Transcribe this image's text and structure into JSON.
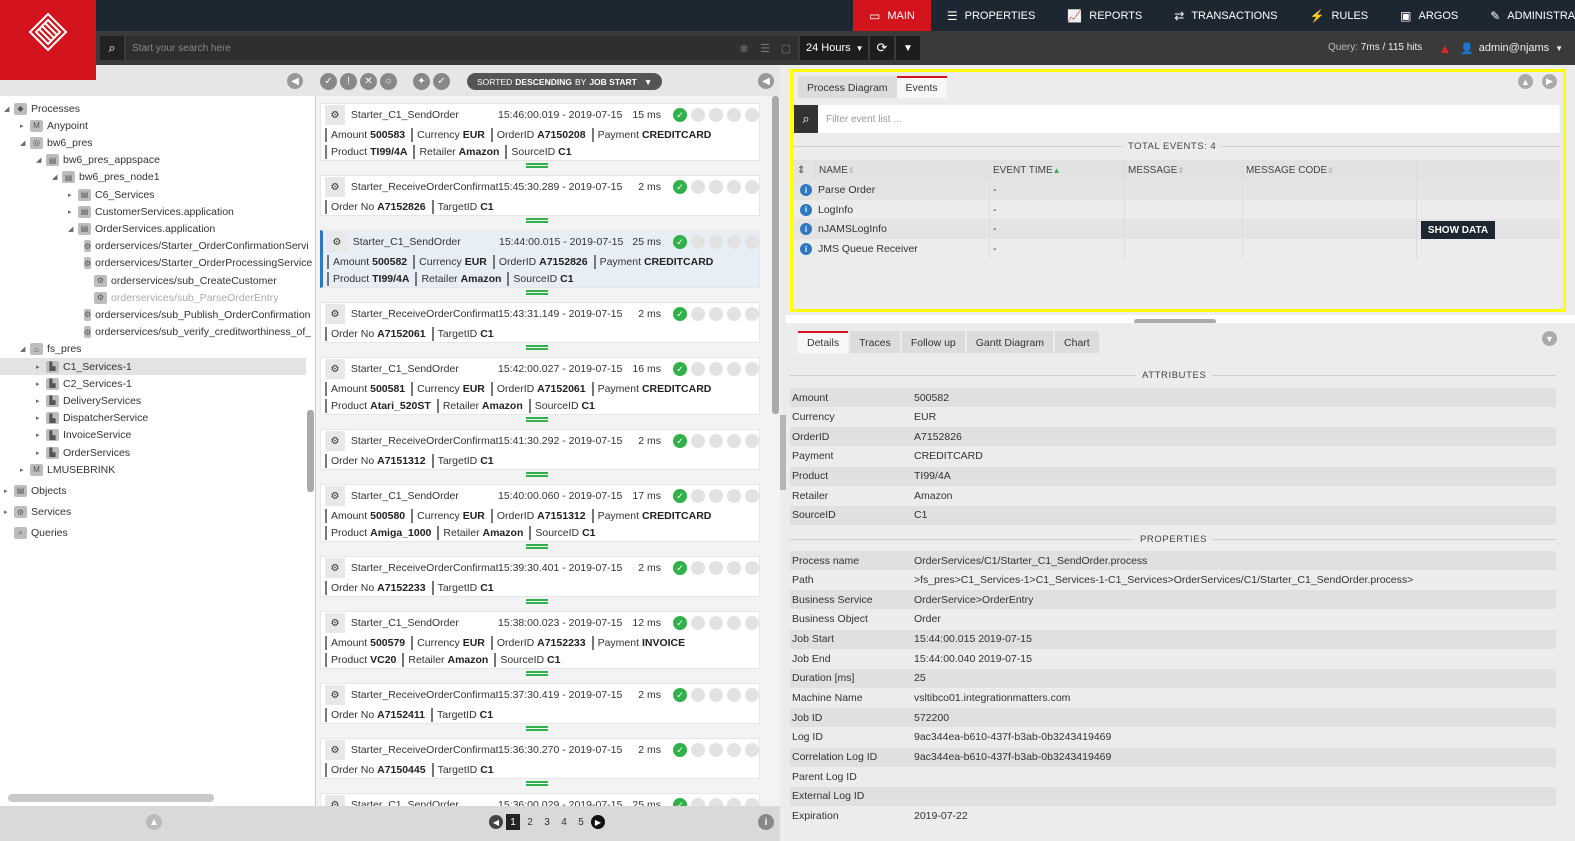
{
  "nav": {
    "items": [
      {
        "label": "MAIN",
        "icon": "monitor-icon",
        "glyph": "▭",
        "active": true
      },
      {
        "label": "PROPERTIES",
        "icon": "list-icon",
        "glyph": "☰",
        "active": false
      },
      {
        "label": "REPORTS",
        "icon": "chart-icon",
        "glyph": "📈",
        "active": false
      },
      {
        "label": "TRANSACTIONS",
        "icon": "exchange-icon",
        "glyph": "⇄",
        "active": false
      },
      {
        "label": "RULES",
        "icon": "bolt-icon",
        "glyph": "⚡",
        "active": false
      },
      {
        "label": "ARGOS",
        "icon": "window-icon",
        "glyph": "▣",
        "active": false
      },
      {
        "label": "ADMINISTRATION",
        "icon": "wrench-icon",
        "glyph": "✎",
        "active": false
      }
    ]
  },
  "search": {
    "placeholder": "Start your search here",
    "timerange": "24 Hours"
  },
  "query": {
    "label": "Query:",
    "value": "7ms / 115 hits"
  },
  "user": {
    "name": "admin@njams"
  },
  "tree": [
    {
      "label": "Processes",
      "indent": 0,
      "tw": "◢",
      "icon": "◆"
    },
    {
      "label": "Anypoint",
      "indent": 1,
      "tw": "▸",
      "icon": "M"
    },
    {
      "label": "bw6_pres",
      "indent": 1,
      "tw": "◢",
      "icon": "◎"
    },
    {
      "label": "bw6_pres_appspace",
      "indent": 2,
      "tw": "◢",
      "icon": "▤"
    },
    {
      "label": "bw6_pres_node1",
      "indent": 3,
      "tw": "◢",
      "icon": "▤"
    },
    {
      "label": "C6_Services",
      "indent": 4,
      "tw": "▸",
      "icon": "▤"
    },
    {
      "label": "CustomerServices.application",
      "indent": 4,
      "tw": "▸",
      "icon": "▤"
    },
    {
      "label": "OrderServices.application",
      "indent": 4,
      "tw": "◢",
      "icon": "▤"
    },
    {
      "label": "orderservices/Starter_OrderConfirmationServi",
      "indent": 5,
      "tw": "",
      "icon": "⚙"
    },
    {
      "label": "orderservices/Starter_OrderProcessingService",
      "indent": 5,
      "tw": "",
      "icon": "⚙"
    },
    {
      "label": "orderservices/sub_CreateCustomer",
      "indent": 5,
      "tw": "",
      "icon": "⚙"
    },
    {
      "label": "orderservices/sub_ParseOrderEntry",
      "indent": 5,
      "tw": "",
      "icon": "⚙",
      "dim": true
    },
    {
      "label": "orderservices/sub_Publish_OrderConfirmation",
      "indent": 5,
      "tw": "",
      "icon": "⚙"
    },
    {
      "label": "orderservices/sub_verify_creditworthiness_of_",
      "indent": 5,
      "tw": "",
      "icon": "⚙"
    },
    {
      "label": "fs_pres",
      "indent": 1,
      "tw": "◢",
      "icon": "⌂"
    },
    {
      "label": "C1_Services-1",
      "indent": 2,
      "tw": "▸",
      "icon": "▙",
      "sel": true
    },
    {
      "label": "C2_Services-1",
      "indent": 2,
      "tw": "▸",
      "icon": "▙"
    },
    {
      "label": "DeliveryServices",
      "indent": 2,
      "tw": "▸",
      "icon": "▙"
    },
    {
      "label": "DispatcherService",
      "indent": 2,
      "tw": "▸",
      "icon": "▙"
    },
    {
      "label": "InvoiceService",
      "indent": 2,
      "tw": "▸",
      "icon": "▙"
    },
    {
      "label": "OrderServices",
      "indent": 2,
      "tw": "▸",
      "icon": "▙"
    },
    {
      "label": "LMUSEBRINK",
      "indent": 1,
      "tw": "▸",
      "icon": "M"
    },
    {
      "label": "Objects",
      "indent": 0,
      "tw": "▸",
      "icon": "▤"
    },
    {
      "label": "Services",
      "indent": 0,
      "tw": "▸",
      "icon": "⚙"
    },
    {
      "label": "Queries",
      "indent": 0,
      "tw": "",
      "icon": "⌕"
    }
  ],
  "sorted": {
    "prefix": "SORTED",
    "strong": "DESCENDING",
    "by": "BY",
    "field": "JOB START"
  },
  "jobs": [
    {
      "name": "Starter_C1_SendOrder",
      "time": "15:46:00.019 - 2019-07-15",
      "dur": "15 ms",
      "attrs": [
        [
          "Amount",
          "500583"
        ],
        [
          "Currency",
          "EUR"
        ],
        [
          "OrderID",
          "A7150208"
        ],
        [
          "Payment",
          "CREDITCARD"
        ],
        [
          "Product",
          "TI99/4A"
        ],
        [
          "Retailer",
          "Amazon"
        ],
        [
          "SourceID",
          "C1"
        ]
      ]
    },
    {
      "name": "Starter_ReceiveOrderConfirmat",
      "time": "15:45:30.289 - 2019-07-15",
      "dur": "2 ms",
      "attrs": [
        [
          "Order No",
          "A7152826"
        ],
        [
          "TargetID",
          "C1"
        ]
      ]
    },
    {
      "name": "Starter_C1_SendOrder",
      "time": "15:44:00.015 - 2019-07-15",
      "dur": "25 ms",
      "sel": true,
      "attrs": [
        [
          "Amount",
          "500582"
        ],
        [
          "Currency",
          "EUR"
        ],
        [
          "OrderID",
          "A7152826"
        ],
        [
          "Payment",
          "CREDITCARD"
        ],
        [
          "Product",
          "TI99/4A"
        ],
        [
          "Retailer",
          "Amazon"
        ],
        [
          "SourceID",
          "C1"
        ]
      ]
    },
    {
      "name": "Starter_ReceiveOrderConfirmat",
      "time": "15:43:31.149 - 2019-07-15",
      "dur": "2 ms",
      "attrs": [
        [
          "Order No",
          "A7152061"
        ],
        [
          "TargetID",
          "C1"
        ]
      ]
    },
    {
      "name": "Starter_C1_SendOrder",
      "time": "15:42:00.027 - 2019-07-15",
      "dur": "16 ms",
      "attrs": [
        [
          "Amount",
          "500581"
        ],
        [
          "Currency",
          "EUR"
        ],
        [
          "OrderID",
          "A7152061"
        ],
        [
          "Payment",
          "CREDITCARD"
        ],
        [
          "Product",
          "Atari_520ST"
        ],
        [
          "Retailer",
          "Amazon"
        ],
        [
          "SourceID",
          "C1"
        ]
      ]
    },
    {
      "name": "Starter_ReceiveOrderConfirmat",
      "time": "15:41:30.292 - 2019-07-15",
      "dur": "2 ms",
      "attrs": [
        [
          "Order No",
          "A7151312"
        ],
        [
          "TargetID",
          "C1"
        ]
      ]
    },
    {
      "name": "Starter_C1_SendOrder",
      "time": "15:40:00.060 - 2019-07-15",
      "dur": "17 ms",
      "attrs": [
        [
          "Amount",
          "500580"
        ],
        [
          "Currency",
          "EUR"
        ],
        [
          "OrderID",
          "A7151312"
        ],
        [
          "Payment",
          "CREDITCARD"
        ],
        [
          "Product",
          "Amiga_1000"
        ],
        [
          "Retailer",
          "Amazon"
        ],
        [
          "SourceID",
          "C1"
        ]
      ]
    },
    {
      "name": "Starter_ReceiveOrderConfirmat",
      "time": "15:39:30.401 - 2019-07-15",
      "dur": "2 ms",
      "attrs": [
        [
          "Order No",
          "A7152233"
        ],
        [
          "TargetID",
          "C1"
        ]
      ]
    },
    {
      "name": "Starter_C1_SendOrder",
      "time": "15:38:00.023 - 2019-07-15",
      "dur": "12 ms",
      "attrs": [
        [
          "Amount",
          "500579"
        ],
        [
          "Currency",
          "EUR"
        ],
        [
          "OrderID",
          "A7152233"
        ],
        [
          "Payment",
          "INVOICE"
        ],
        [
          "Product",
          "VC20"
        ],
        [
          "Retailer",
          "Amazon"
        ],
        [
          "SourceID",
          "C1"
        ]
      ]
    },
    {
      "name": "Starter_ReceiveOrderConfirmat",
      "time": "15:37:30.419 - 2019-07-15",
      "dur": "2 ms",
      "attrs": [
        [
          "Order No",
          "A7152411"
        ],
        [
          "TargetID",
          "C1"
        ]
      ]
    },
    {
      "name": "Starter_ReceiveOrderConfirmat",
      "time": "15:36:30.270 - 2019-07-15",
      "dur": "2 ms",
      "attrs": [
        [
          "Order No",
          "A7150445"
        ],
        [
          "TargetID",
          "C1"
        ]
      ]
    },
    {
      "name": "Starter_C1_SendOrder",
      "time": "15:36:00.029 - 2019-07-15",
      "dur": "25 ms",
      "attrs": []
    }
  ],
  "pager": {
    "pages": [
      "1",
      "2",
      "3",
      "4",
      "5"
    ],
    "current": "1"
  },
  "events": {
    "tabs": [
      "Process Diagram",
      "Events"
    ],
    "active_tab": "Events",
    "filter_placeholder": "Filter event list ...",
    "total_label": "TOTAL EVENTS: 4",
    "columns": [
      "NAME",
      "EVENT TIME",
      "MESSAGE",
      "MESSAGE CODE"
    ],
    "rows": [
      {
        "name": "Parse Order",
        "time": "-",
        "message": "",
        "code": ""
      },
      {
        "name": "LogInfo",
        "time": "-",
        "message": "",
        "code": ""
      },
      {
        "name": "nJAMSLogInfo",
        "time": "-",
        "message": "",
        "code": ""
      },
      {
        "name": "JMS Queue Receiver",
        "time": "-",
        "message": "",
        "code": ""
      }
    ],
    "show_data": "SHOW DATA"
  },
  "details": {
    "tabs": [
      "Details",
      "Traces",
      "Follow up",
      "Gantt Diagram",
      "Chart"
    ],
    "active_tab": "Details",
    "attributes_title": "ATTRIBUTES",
    "attributes": [
      [
        "Amount",
        "500582"
      ],
      [
        "Currency",
        "EUR"
      ],
      [
        "OrderID",
        "A7152826"
      ],
      [
        "Payment",
        "CREDITCARD"
      ],
      [
        "Product",
        "TI99/4A"
      ],
      [
        "Retailer",
        "Amazon"
      ],
      [
        "SourceID",
        "C1"
      ]
    ],
    "properties_title": "PROPERTIES",
    "properties": [
      [
        "Process name",
        "OrderServices/C1/Starter_C1_SendOrder.process"
      ],
      [
        "Path",
        ">fs_pres>C1_Services-1>C1_Services-1-C1_Services>OrderServices/C1/Starter_C1_SendOrder.process>"
      ],
      [
        "Business Service",
        "OrderService>OrderEntry"
      ],
      [
        "Business Object",
        "Order"
      ],
      [
        "Job Start",
        "15:44:00.015  2019-07-15"
      ],
      [
        "Job End",
        "15:44:00.040  2019-07-15"
      ],
      [
        "Duration [ms]",
        "25"
      ],
      [
        "Machine Name",
        "vsltibco01.integrationmatters.com"
      ],
      [
        "Job ID",
        "572200"
      ],
      [
        "Log ID",
        "9ac344ea-b610-437f-b3ab-0b3243419469"
      ],
      [
        "Correlation Log ID",
        "9ac344ea-b610-437f-b3ab-0b3243419469"
      ],
      [
        "Parent Log ID",
        ""
      ],
      [
        "External Log ID",
        ""
      ],
      [
        "Expiration",
        "2019-07-22"
      ]
    ]
  },
  "colors": {
    "brand_red": "#d4141c",
    "highlight": "#ffff00",
    "ok_green": "#31b149",
    "navy": "#1d2732"
  }
}
